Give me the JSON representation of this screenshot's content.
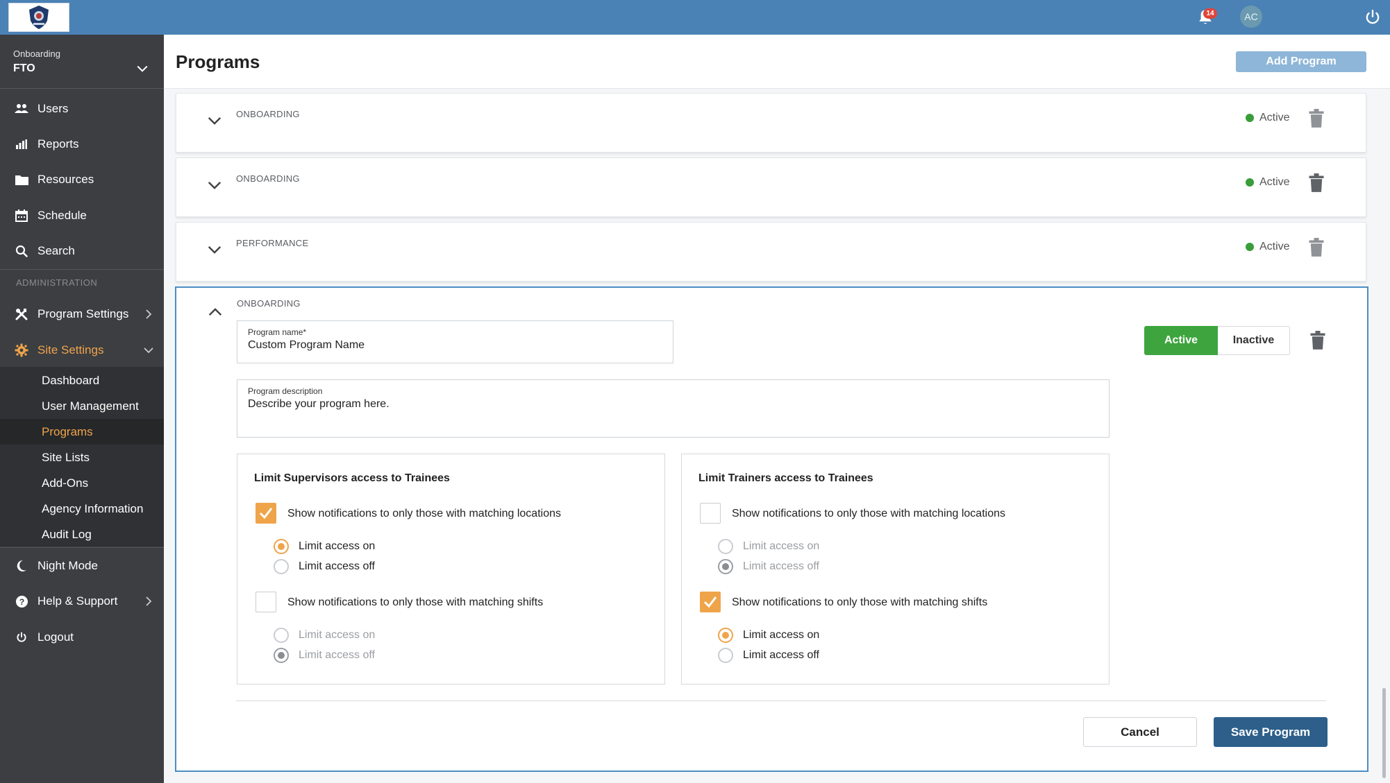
{
  "topbar": {
    "notifications_count": "14",
    "avatar_initials": "AC",
    "brand_color": "#4a82b6"
  },
  "sidebar": {
    "program_selector": {
      "label": "Onboarding",
      "value": "FTO"
    },
    "items": [
      {
        "label": "Users",
        "icon": "users-icon"
      },
      {
        "label": "Reports",
        "icon": "bar-chart-icon"
      },
      {
        "label": "Resources",
        "icon": "folder-icon"
      },
      {
        "label": "Schedule",
        "icon": "calendar-icon"
      },
      {
        "label": "Search",
        "icon": "search-icon"
      }
    ],
    "admin_heading": "ADMINISTRATION",
    "program_settings": "Program Settings",
    "site_settings": "Site Settings",
    "site_settings_sub": [
      "Dashboard",
      "User Management",
      "Programs",
      "Site Lists",
      "Add-Ons",
      "Agency Information",
      "Audit Log"
    ],
    "night_mode": "Night Mode",
    "help_support": "Help & Support",
    "logout": "Logout",
    "accent_color": "#f0a44a"
  },
  "main": {
    "title": "Programs",
    "add_button": "Add Program",
    "cards": [
      {
        "type": "ONBOARDING",
        "status": "Active"
      },
      {
        "type": "ONBOARDING",
        "status": "Active"
      },
      {
        "type": "PERFORMANCE",
        "status": "Active"
      }
    ],
    "expanded": {
      "type": "ONBOARDING",
      "name_label": "Program name*",
      "name_value": "Custom Program Name",
      "description_label": "Program description",
      "description_value": "Describe your program here.",
      "toggle_active": "Active",
      "toggle_inactive": "Inactive",
      "supervisors": {
        "title": "Limit Supervisors access to Trainees",
        "locations_label": "Show notifications to only those with matching locations",
        "shifts_label": "Show notifications to only those with matching shifts",
        "on": "Limit access on",
        "off": "Limit access off"
      },
      "trainers": {
        "title": "Limit Trainers access to Trainees",
        "locations_label": "Show notifications to only those with matching locations",
        "shifts_label": "Show notifications to only those with matching shifts",
        "on": "Limit access on",
        "off": "Limit access off"
      },
      "cancel": "Cancel",
      "save": "Save Program"
    }
  }
}
